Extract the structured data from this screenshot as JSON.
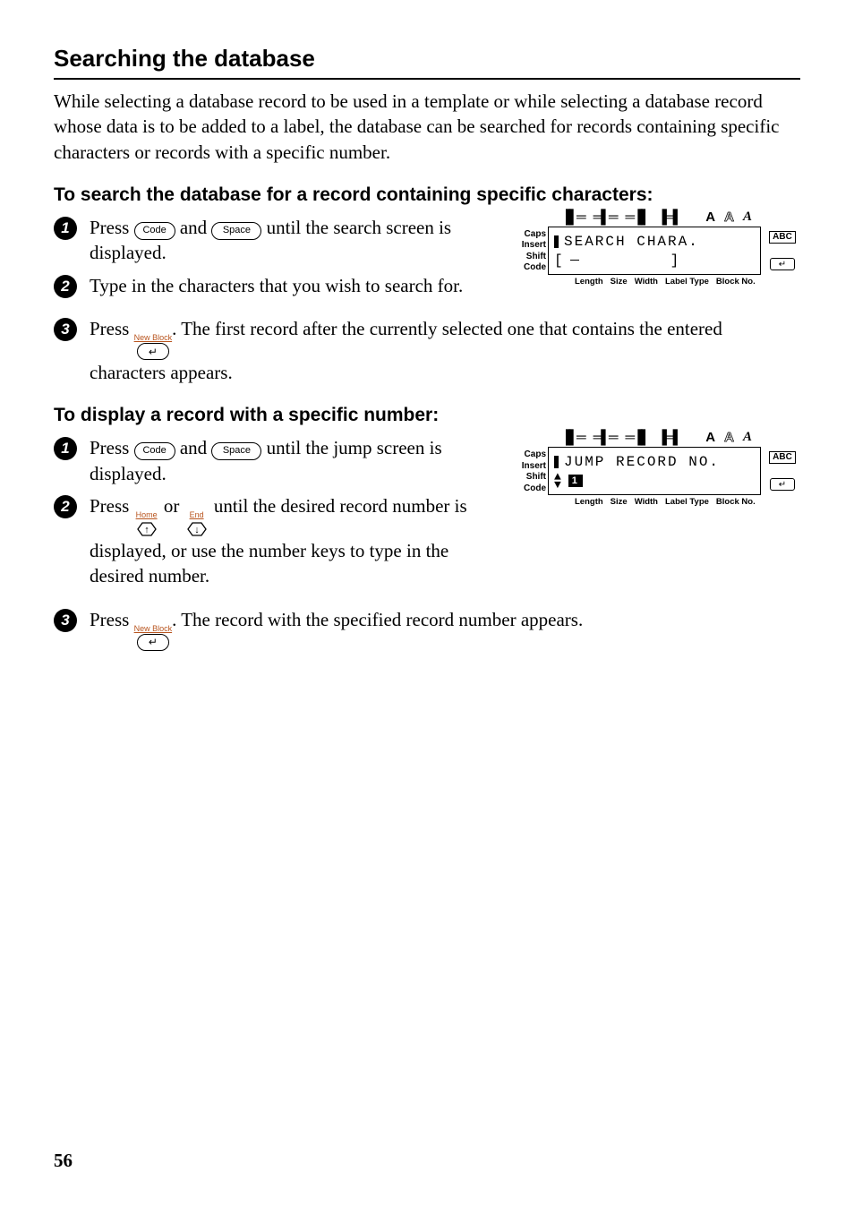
{
  "title": "Searching the database",
  "intro": "While selecting a database record to be used in a template or while selecting a database record whose data is to be added to a label, the database can be searched for records containing specific characters or records with a specific number.",
  "sectionA": {
    "heading": "To search the database for a record containing specific characters:",
    "steps": {
      "s1a": "Press ",
      "s1b": " and ",
      "s1c": " until the search screen is displayed.",
      "s2": "Type in the characters that you wish to search for.",
      "s3a": "Press ",
      "s3b": ". The first record after the currently selected one that contains the entered characters appears."
    }
  },
  "sectionB": {
    "heading": "To display a record with a specific number:",
    "steps": {
      "s1a": "Press ",
      "s1b": " and ",
      "s1c": " until the jump screen is displayed.",
      "s2a": "Press ",
      "s2b": " or ",
      "s2c": " until the desired record number is displayed, or use the number keys to type in the desired number.",
      "s3a": "Press ",
      "s3b": ". The record with the specified record number appears."
    }
  },
  "keys": {
    "code": "Code",
    "space": "Space",
    "newblock": "New Block",
    "home": "Home",
    "end": "End"
  },
  "lcd": {
    "side": {
      "caps": "Caps",
      "insert": "Insert",
      "shift": "Shift",
      "code": "Code"
    },
    "abc": "ABC",
    "bottom": {
      "length": "Length",
      "size": "Size",
      "width": "Width",
      "labeltype": "Label Type",
      "blockno": "Block No."
    },
    "fig1": {
      "line1": "SEARCH CHARA.",
      "line2a": "[",
      "line2b": "]"
    },
    "fig2": {
      "line1": "JUMP RECORD NO.",
      "num": "1"
    }
  },
  "pageNumber": "56"
}
